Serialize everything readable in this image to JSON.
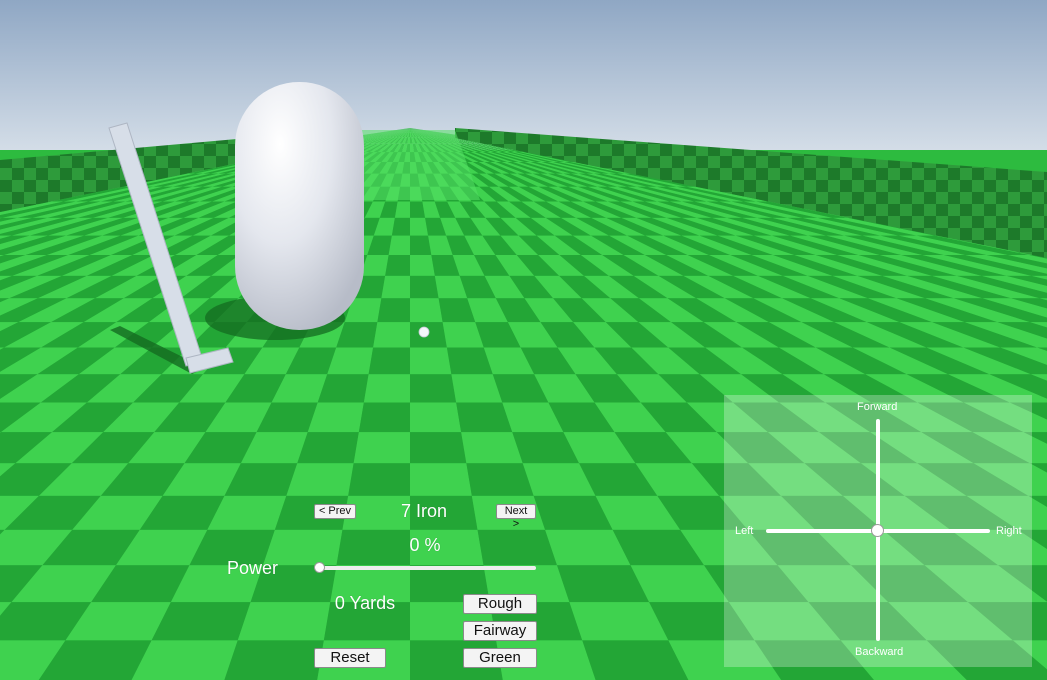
{
  "colors": {
    "sky_top": "#8fa7c4",
    "sky_bottom": "#e8eef2",
    "grass_light": "#3fd24f",
    "grass_dark": "#23a636",
    "wall_light": "#2f9a3a",
    "wall_dark": "#1d7a2a",
    "player": "#e6e9f0",
    "club": "#d7dee8"
  },
  "club_selector": {
    "prev_label": "< Prev",
    "club_name": "7 Iron",
    "next_label": "Next >"
  },
  "power": {
    "percent_text": "0 %",
    "label": "Power",
    "value": 0
  },
  "distance_text": "0 Yards",
  "lie_buttons": {
    "rough": "Rough",
    "fairway": "Fairway",
    "green": "Green"
  },
  "reset_label": "Reset",
  "direction_pad": {
    "forward": "Forward",
    "backward": "Backward",
    "left": "Left",
    "right": "Right"
  }
}
